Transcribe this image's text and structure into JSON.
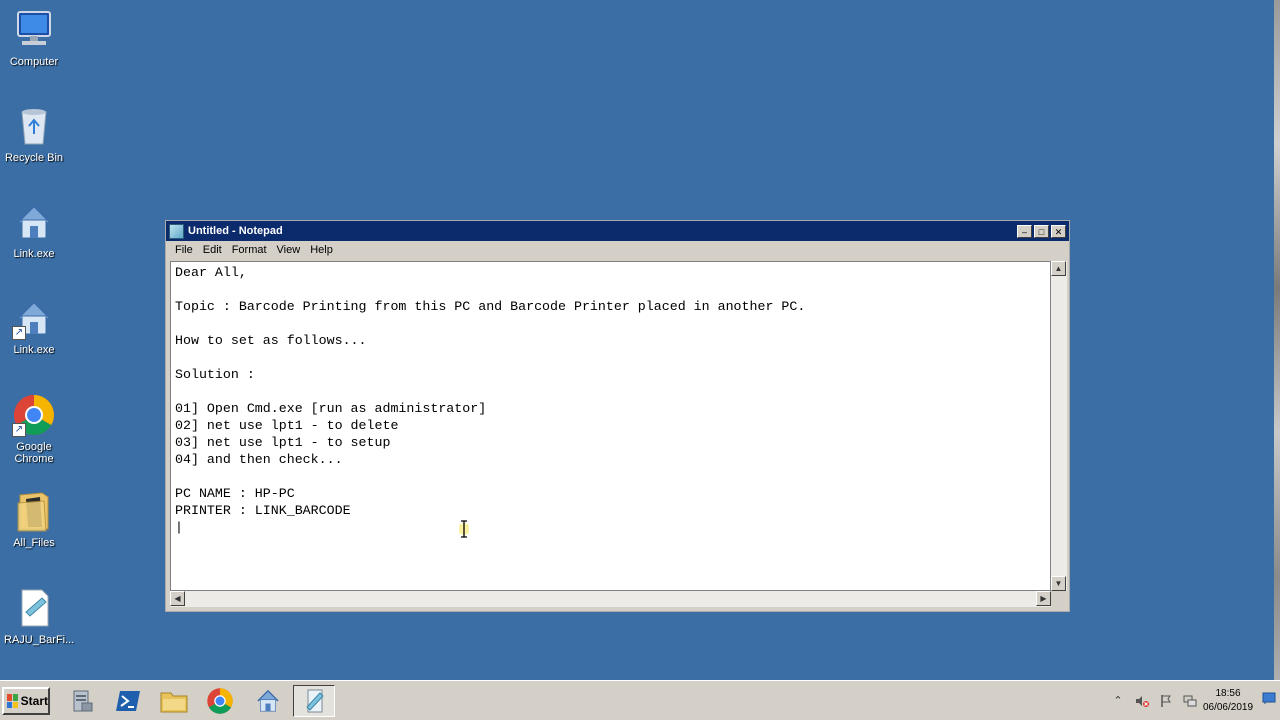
{
  "desktop": {
    "icons": [
      {
        "label": "Computer"
      },
      {
        "label": "Recycle Bin"
      },
      {
        "label": "Link.exe"
      },
      {
        "label": "Link.exe"
      },
      {
        "label": "Google Chrome"
      },
      {
        "label": "All_Files"
      },
      {
        "label": "RAJU_BarFi..."
      }
    ]
  },
  "notepad": {
    "title": "Untitled - Notepad",
    "menu": [
      "File",
      "Edit",
      "Format",
      "View",
      "Help"
    ],
    "content": "Dear All,\n\nTopic : Barcode Printing from this PC and Barcode Printer placed in another PC.\n\nHow to set as follows...\n\nSolution :\n\n01] Open Cmd.exe [run as administrator]\n02] net use lpt1 - to delete\n03] net use lpt1 - to setup\n04] and then check...\n\nPC NAME : HP-PC\nPRINTER : LINK_BARCODE\n|"
  },
  "taskbar": {
    "start_label": "Start",
    "clock_time": "18:56",
    "clock_date": "06/06/2019"
  },
  "colors": {
    "desktop": "#3a6ea5",
    "titlebar": "#0c2b6d"
  }
}
